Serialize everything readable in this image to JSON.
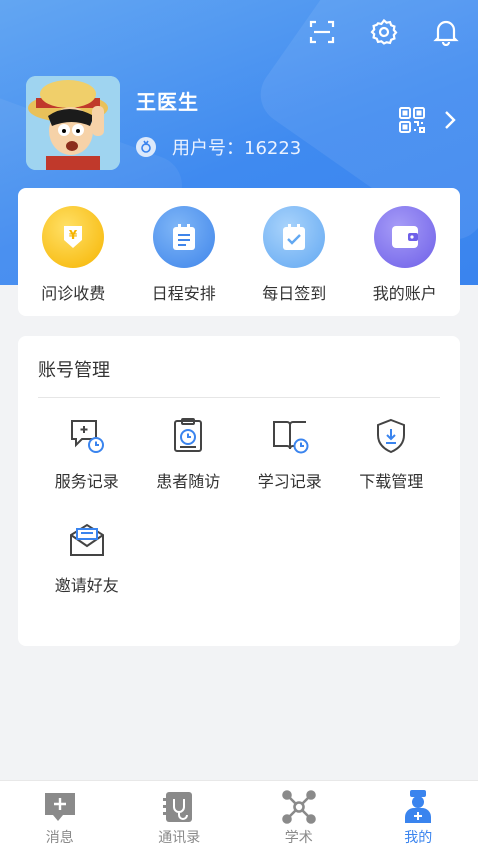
{
  "header": {
    "scan_icon": "scan-icon",
    "settings_icon": "gear-icon",
    "notification_icon": "bell-icon"
  },
  "profile": {
    "name": "王医生",
    "user_id_label": "用户号：16223",
    "qr_icon": "qrcode-icon"
  },
  "quick_actions": [
    {
      "label": "问诊收费",
      "icon": "yen-icon",
      "color": "#f7b500"
    },
    {
      "label": "日程安排",
      "icon": "schedule-icon",
      "color": "#4a90ee"
    },
    {
      "label": "每日签到",
      "icon": "checkin-icon",
      "color": "#6eb1f7"
    },
    {
      "label": "我的账户",
      "icon": "wallet-icon",
      "color": "#7a6cf0"
    }
  ],
  "account": {
    "title": "账号管理",
    "items": [
      {
        "label": "服务记录",
        "icon": "service-record-icon"
      },
      {
        "label": "患者随访",
        "icon": "patient-followup-icon"
      },
      {
        "label": "学习记录",
        "icon": "study-record-icon"
      },
      {
        "label": "下载管理",
        "icon": "download-manage-icon"
      },
      {
        "label": "邀请好友",
        "icon": "invite-mail-icon"
      }
    ]
  },
  "tabbar": {
    "items": [
      {
        "label": "消息",
        "icon": "message-icon",
        "active": false
      },
      {
        "label": "通讯录",
        "icon": "contacts-icon",
        "active": false
      },
      {
        "label": "学术",
        "icon": "academic-icon",
        "active": false
      },
      {
        "label": "我的",
        "icon": "doctor-icon",
        "active": true
      }
    ],
    "active_color": "#3a84ee",
    "inactive_color": "#8a8a8a"
  }
}
